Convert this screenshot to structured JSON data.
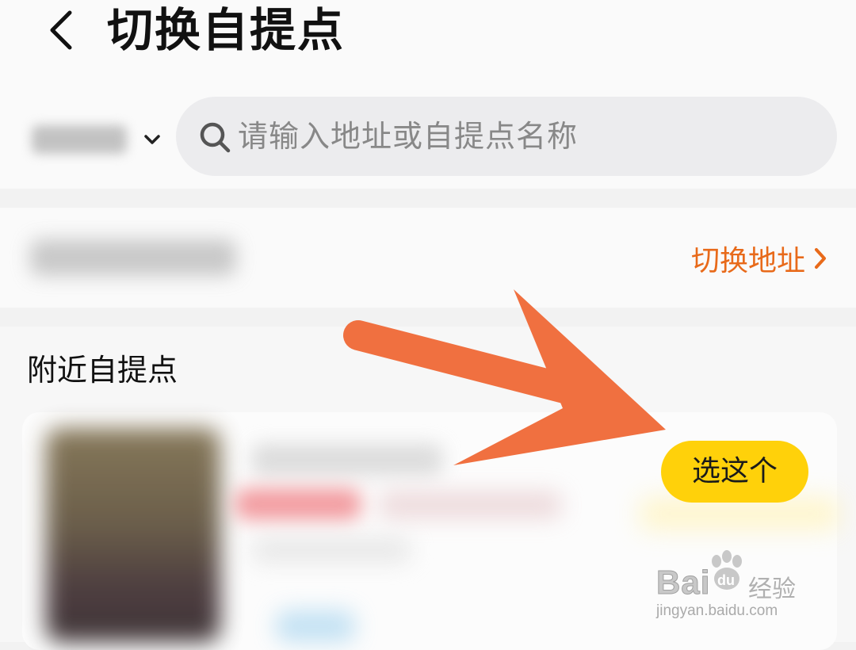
{
  "header": {
    "title": "切换自提点",
    "back_icon": "chevron-left-icon"
  },
  "search": {
    "placeholder": "请输入地址或自提点名称",
    "icon": "search-icon",
    "city_dropdown_icon": "chevron-down-icon"
  },
  "address": {
    "switch_label": "切换地址"
  },
  "nearby": {
    "title": "附近自提点",
    "items": [
      {
        "button_label": "选这个"
      }
    ]
  },
  "annotation": {
    "type": "arrow",
    "color": "#f07040"
  },
  "watermark": {
    "brand": "Bai",
    "brand_tail": "经验",
    "url": "jingyan.baidu.com"
  },
  "colors": {
    "accent_orange": "#e86a1a",
    "button_yellow": "#ffd10a"
  }
}
